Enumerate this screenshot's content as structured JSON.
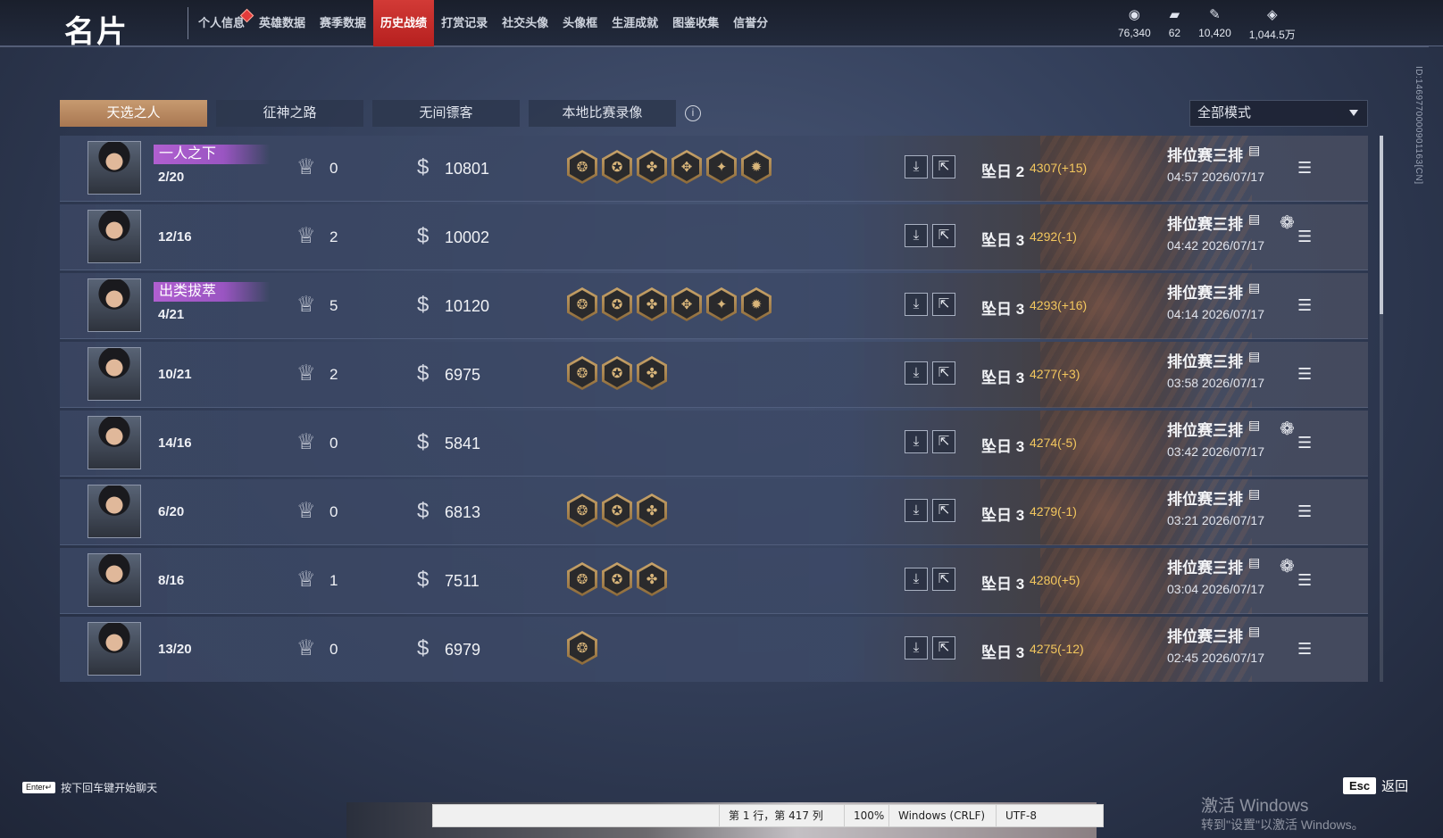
{
  "header": {
    "title": "名片",
    "nav": [
      {
        "label": "个人信息",
        "dot": true
      },
      {
        "label": "英雄数据"
      },
      {
        "label": "赛季数据"
      },
      {
        "label": "历史战绩",
        "active": true
      },
      {
        "label": "打赏记录"
      },
      {
        "label": "社交头像"
      },
      {
        "label": "头像框"
      },
      {
        "label": "生涯成就"
      },
      {
        "label": "图鉴收集"
      },
      {
        "label": "信誉分"
      }
    ],
    "currencies": [
      {
        "icon": "coin-icon",
        "value": "76,340"
      },
      {
        "icon": "ticket-icon",
        "value": "62"
      },
      {
        "icon": "feather-icon",
        "value": "10,420"
      },
      {
        "icon": "gem-icon",
        "value": "1,044.5万"
      }
    ]
  },
  "side_id": "ID:1469770000901163[CN]",
  "tabs": [
    {
      "label": "天选之人",
      "active": true
    },
    {
      "label": "征神之路"
    },
    {
      "label": "无间镖客"
    },
    {
      "label": "本地比赛录像"
    }
  ],
  "mode_filter": {
    "selected": "全部模式"
  },
  "matches": [
    {
      "badge": "一人之下",
      "kda": "2/20",
      "mvp": "0",
      "gold": "10801",
      "medals": 6,
      "rank": "坠日 2",
      "score": "4307(+15)",
      "mode": "排位赛三排",
      "time": "04:57 2026/07/17",
      "team_icon": false
    },
    {
      "badge": "",
      "kda": "12/16",
      "mvp": "2",
      "gold": "10002",
      "medals": 0,
      "rank": "坠日 3",
      "score": "4292(-1)",
      "mode": "排位赛三排",
      "time": "04:42 2026/07/17",
      "team_icon": true
    },
    {
      "badge": "出类拔萃",
      "kda": "4/21",
      "mvp": "5",
      "gold": "10120",
      "medals": 6,
      "rank": "坠日 3",
      "score": "4293(+16)",
      "mode": "排位赛三排",
      "time": "04:14 2026/07/17",
      "team_icon": false
    },
    {
      "badge": "",
      "kda": "10/21",
      "mvp": "2",
      "gold": "6975",
      "medals": 3,
      "rank": "坠日 3",
      "score": "4277(+3)",
      "mode": "排位赛三排",
      "time": "03:58 2026/07/17",
      "team_icon": false
    },
    {
      "badge": "",
      "kda": "14/16",
      "mvp": "0",
      "gold": "5841",
      "medals": 0,
      "rank": "坠日 3",
      "score": "4274(-5)",
      "mode": "排位赛三排",
      "time": "03:42 2026/07/17",
      "team_icon": true
    },
    {
      "badge": "",
      "kda": "6/20",
      "mvp": "0",
      "gold": "6813",
      "medals": 3,
      "rank": "坠日 3",
      "score": "4279(-1)",
      "mode": "排位赛三排",
      "time": "03:21 2026/07/17",
      "team_icon": false
    },
    {
      "badge": "",
      "kda": "8/16",
      "mvp": "1",
      "gold": "7511",
      "medals": 3,
      "rank": "坠日 3",
      "score": "4280(+5)",
      "mode": "排位赛三排",
      "time": "03:04 2026/07/17",
      "team_icon": true
    },
    {
      "badge": "",
      "kda": "13/20",
      "mvp": "0",
      "gold": "6979",
      "medals": 1,
      "rank": "坠日 3",
      "score": "4275(-12)",
      "mode": "排位赛三排",
      "time": "02:45 2026/07/17",
      "team_icon": false
    }
  ],
  "footer": {
    "enter_key": "Enter↵",
    "enter_hint": "按下回车键开始聊天",
    "esc_key": "Esc",
    "esc_label": "返回",
    "win_activate": "激活 Windows",
    "win_activate_sub": "转到\"设置\"以激活 Windows。"
  },
  "statusbar": {
    "position": "第 1 行，第 417 列",
    "zoom": "100%",
    "eol": "Windows (CRLF)",
    "encoding": "UTF-8"
  },
  "colors": {
    "accent_tab": "#b8875f",
    "active_nav": "#c42b29",
    "score_gold": "#f3c75e",
    "badge_purple": "#a85bcd"
  }
}
